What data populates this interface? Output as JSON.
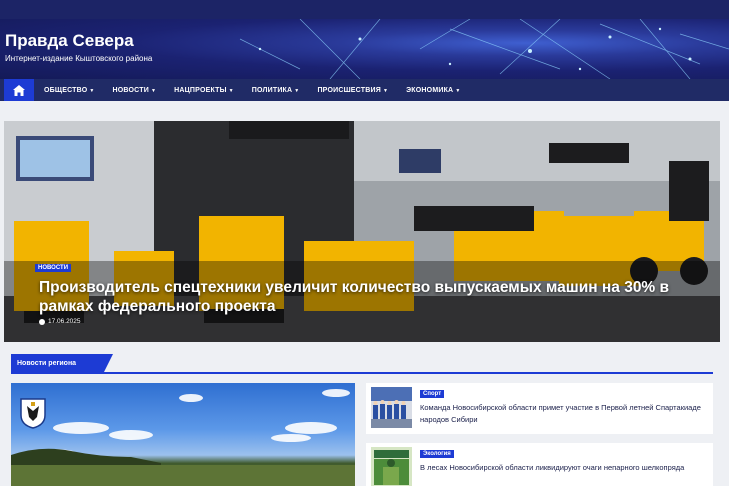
{
  "site": {
    "title": "Правда Севера",
    "tagline": "Интернет-издание Кыштовского района"
  },
  "nav": {
    "home_icon": "home-icon",
    "items": [
      {
        "label": "ОБЩЕСТВО"
      },
      {
        "label": "НОВОСТИ"
      },
      {
        "label": "НАЦПРОЕКТЫ"
      },
      {
        "label": "ПОЛИТИКА"
      },
      {
        "label": "ПРОИСШЕСТВИЯ"
      },
      {
        "label": "ЭКОНОМИКА"
      }
    ]
  },
  "hero": {
    "badge": "НОВОСТИ",
    "title": "Производитель спецтехники увеличит количество выпускаемых машин на 30% в рамках федерального проекта",
    "date": "17.06.2025"
  },
  "section": {
    "title": "Новости региона"
  },
  "side_news": [
    {
      "category": "Спорт",
      "title": "Команда Новосибирской области примет участие в Первой летней Спартакиаде народов Сибири"
    },
    {
      "category": "Экология",
      "title": "В лесах Новосибирской области ликвидируют очаги непарного шелкопряда"
    }
  ],
  "colors": {
    "accent": "#1d3bd4",
    "nav_bg": "#202b66",
    "top_bar": "#1c2466",
    "ecology_badge": "#1d3bd4",
    "sport_badge": "#1d3bd4"
  }
}
